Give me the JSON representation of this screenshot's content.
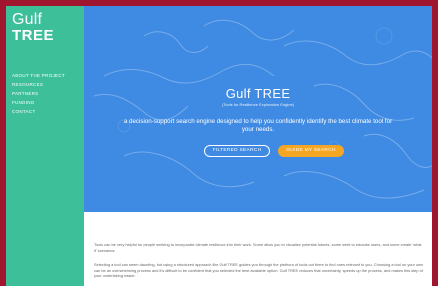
{
  "sidebar": {
    "logo_line1": "Gulf",
    "logo_line2": "TREE",
    "nav": [
      "ABOUT THE PROJECT",
      "RESOURCES",
      "PARTNERS",
      "FUNDING",
      "CONTACT"
    ]
  },
  "hero": {
    "title": "Gulf TREE",
    "subtitle": "(Tools for Resilience Exploration Engine)",
    "description": "a decision-support search engine designed to help you confidently identify the best climate tool for your needs.",
    "btn_filtered": "FILTERED SEARCH",
    "btn_guide": "GUIDE MY SEARCH"
  },
  "body": {
    "p1": "Tools can be very helpful for people seeking to incorporate climate resilience into their work. Some allow you to visualize potential futures, some seek to educate users, and some create 'what if' scenarios.",
    "p2": "Selecting a tool can seem daunting, but using a structured approach like Gulf TREE guides you through the plethora of tools out there to find ones relevant to you. Choosing a tool on your own can be an overwhelming process and it's difficult to be confident that you selected the best available option. Gulf TREE reduces that uncertainty, speeds up the process, and makes this step of your undertaking easier."
  },
  "colors": {
    "frame_border": "#a0162e",
    "sidebar": "#3dbf9a",
    "hero": "#3f8ae2",
    "accent_orange": "#f5a623"
  }
}
